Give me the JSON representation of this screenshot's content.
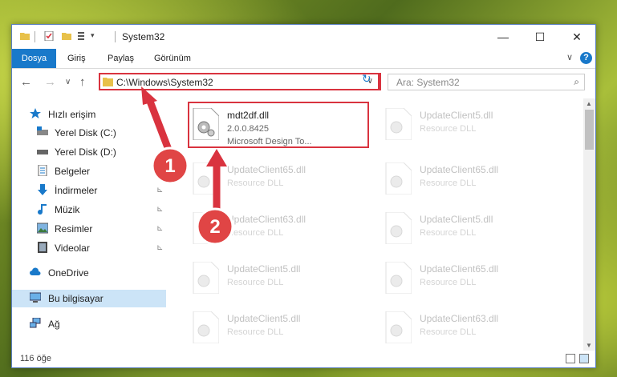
{
  "window": {
    "title": "System32",
    "min_glyph": "—",
    "max_glyph": "☐",
    "close_glyph": "✕"
  },
  "ribbon": {
    "tabs": [
      "Dosya",
      "Giriş",
      "Paylaş",
      "Görünüm"
    ],
    "expand_glyph": "∨",
    "help_glyph": "?"
  },
  "nav": {
    "back": "←",
    "forward": "→",
    "recent": "∨",
    "up": "↑",
    "address": "C:\\Windows\\System32",
    "address_dd": "∨",
    "refresh": "↻",
    "search_placeholder": "Ara: System32",
    "search_icon": "⌕"
  },
  "sidebar": {
    "items": [
      {
        "label": "Hızlı erişim",
        "icon": "star-icon"
      },
      {
        "label": "Yerel Disk (C:)",
        "icon": "drive-icon"
      },
      {
        "label": "Yerel Disk (D:)",
        "icon": "drive-icon"
      },
      {
        "label": "Belgeler",
        "icon": "documents-icon"
      },
      {
        "label": "İndirmeler",
        "icon": "download-icon"
      },
      {
        "label": "Müzik",
        "icon": "music-icon"
      },
      {
        "label": "Resimler",
        "icon": "pictures-icon"
      },
      {
        "label": "Videolar",
        "icon": "videos-icon"
      },
      {
        "label": "OneDrive",
        "icon": "cloud-icon"
      },
      {
        "label": "Bu bilgisayar",
        "icon": "computer-icon"
      },
      {
        "label": "Ağ",
        "icon": "network-icon"
      }
    ],
    "pin_glyph": "📌"
  },
  "files": [
    {
      "name": "mdt2df.dll",
      "version": "2.0.0.8425",
      "desc": "Microsoft Design To..."
    },
    {
      "name": "UpdateClient5.dll",
      "desc": "Resource DLL"
    },
    {
      "name": "UpdateClient65.dll",
      "desc": "Resource DLL"
    },
    {
      "name": "UpdateClient65.dll",
      "desc": "Resource DLL"
    },
    {
      "name": "UpdateClient63.dll",
      "desc": "Resource DLL"
    },
    {
      "name": "UpdateClient5.dll",
      "desc": "Resource DLL"
    },
    {
      "name": "UpdateClient5.dll",
      "desc": "Resource DLL"
    },
    {
      "name": "UpdateClient65.dll",
      "desc": "Resource DLL"
    },
    {
      "name": "UpdateClient5.dll",
      "desc": "Resource DLL"
    },
    {
      "name": "UpdateClient63.dll",
      "desc": "Resource DLL"
    }
  ],
  "status": {
    "count": "116 öğe"
  },
  "annotations": {
    "badge1": "1",
    "badge2": "2"
  },
  "colors": {
    "accent": "#1979ca",
    "highlight": "#d9333f",
    "selected": "#cce4f7"
  }
}
